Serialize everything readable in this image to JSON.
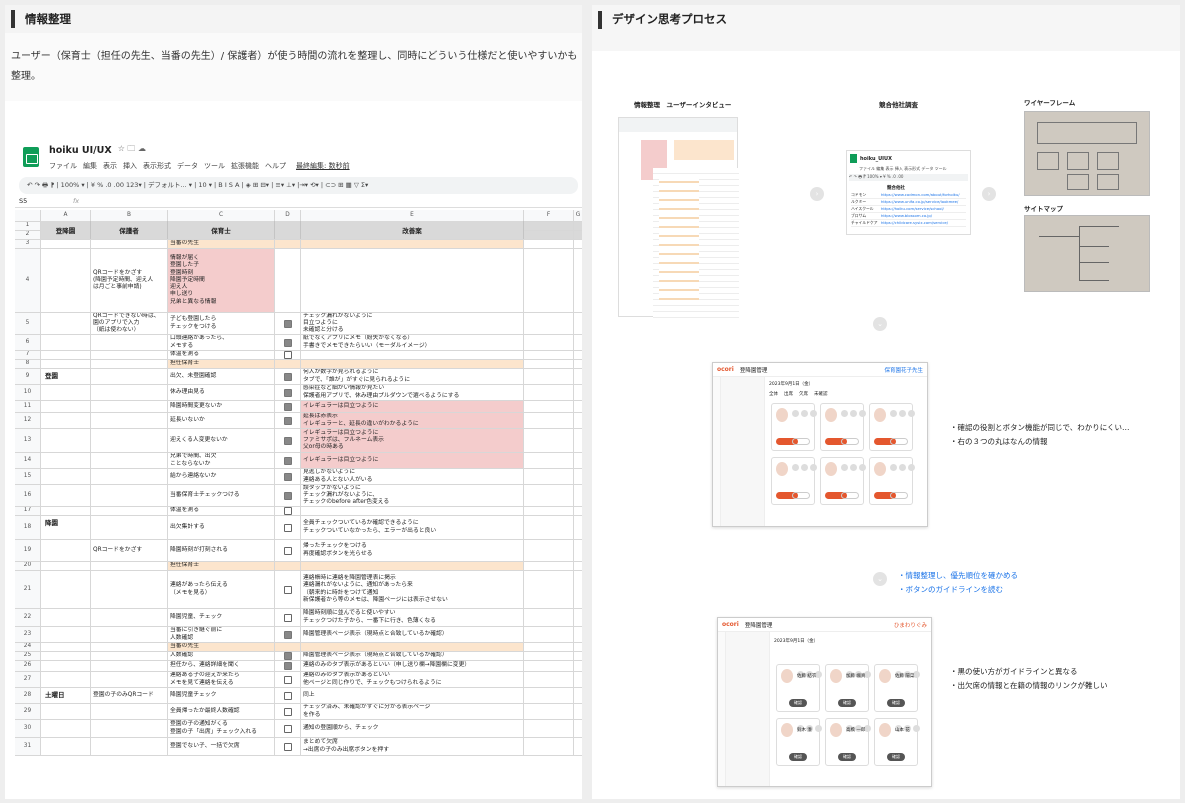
{
  "left": {
    "title": "情報整理",
    "description": "ユーザー（保育士（担任の先生、当番の先生）/ 保護者）が使う時間の流れを整理し、同時にどういう仕様だと使いやすいかも整理。",
    "sheet": {
      "title": "hoiku UI/UX",
      "title_icons": "☆ 🗀 ☁",
      "menu": [
        "ファイル",
        "編集",
        "表示",
        "挿入",
        "表示形式",
        "データ",
        "ツール",
        "拡張機能",
        "ヘルプ"
      ],
      "last_edit": "最終編集: 数秒前",
      "toolbar": "↶ ↷ 🖶 ⁋  |  100% ▾  |  ¥  %  .0  .00  123▾  |  デフォルト... ▾  |  10  ▾  |  B  I  S  A  |  ◈  ⊞  ⊟▾  |  ≡▾  ⊥▾  |⇥▾  ⟲▾  |  ⊂⊃  ⊞  ▦  ▽  Σ▾",
      "cell_ref": "S5",
      "fx": "fx",
      "columns": [
        "",
        "A",
        "B",
        "C",
        "D",
        "E",
        "F",
        "G"
      ],
      "headers": {
        "a": "登降園",
        "b": "保護者",
        "c": "保育士",
        "e": "改善案"
      },
      "merged": {
        "a_toko": "登園",
        "a_koen": "降園",
        "a_sat": "土曜日"
      },
      "rows": [
        {
          "n": "1",
          "b": "",
          "c": "",
          "e": "",
          "chk": "none",
          "style": "hdr"
        },
        {
          "n": "2",
          "b": "",
          "c": "",
          "e": "",
          "chk": "none",
          "style": "hdr"
        },
        {
          "n": "3",
          "b": "",
          "c": "当番の先生",
          "e": "",
          "chk": "none",
          "style": "orange"
        },
        {
          "n": "4",
          "b": "QRコードをかざす\n(降園予定時間、迎え人\nは月ごと事前申請)",
          "c": "情報が届く\n登園した子\n登園時刻\n降園予定時間\n迎え人\n申し送り\n兄弟と異なる情報",
          "e": "",
          "chk": "none",
          "style": "pink"
        },
        {
          "n": "5",
          "b": "QRコードできない時は、\n園のアプリで入力\n（紙は使わない）",
          "c": "子ども登園したら\nチェックをつける",
          "e": "チェック漏れがないように\n目立つように\n未確認と分ける",
          "chk": "on"
        },
        {
          "n": "6",
          "b": "",
          "c": "口頭連絡があったら、\nメモする",
          "e": "紙でなくアプリにメモ（紛失がなくなる）\n手書きでメモできたらいい（モーダルイメージ）",
          "chk": "on"
        },
        {
          "n": "7",
          "b": "",
          "c": "体温を測る",
          "e": "",
          "chk": "off"
        },
        {
          "n": "8",
          "b": "",
          "c": "担任保育士",
          "e": "",
          "chk": "none",
          "style": "orange"
        },
        {
          "n": "9",
          "b": "",
          "c": "出欠、未登園確認",
          "e": "何人か数字が見られるように\nタブで、「誰が」がすぐに見られるように",
          "chk": "on"
        },
        {
          "n": "10",
          "b": "",
          "c": "休み理由見る",
          "e": "感染症など細かい情報が見たい\n保護者用アプリで、休み理由プルダウンで選べるようにする",
          "chk": "on"
        },
        {
          "n": "11",
          "b": "",
          "c": "降園時間変更ないか",
          "e": "イレギュラーは目立つように",
          "chk": "on",
          "style": "pinkE"
        },
        {
          "n": "12",
          "b": "",
          "c": "延長いないか",
          "e": "延長は赤表示\nイレギュラーと、延長の違いがわかるように",
          "chk": "on",
          "style": "pinkE"
        },
        {
          "n": "13",
          "b": "",
          "c": "迎えくる人変更ないか",
          "e": "イレギュラーは目立つように\nファミサポは、フルネーム表示\n父or母の時ある",
          "chk": "on",
          "style": "pinkE"
        },
        {
          "n": "14",
          "b": "",
          "c": "兄弟で時間、出欠\nことならないか",
          "e": "イレギュラーは目立つように",
          "chk": "on",
          "style": "pinkE"
        },
        {
          "n": "15",
          "b": "",
          "c": "給から連絡ないか",
          "e": "見逃しがないように\n連絡ある人とない人がいる",
          "chk": "on"
        },
        {
          "n": "16",
          "b": "",
          "c": "当番保育士チェックつける",
          "e": "誤タップがないように\nチェック漏れがないように、\nチェックのbefore after色変える",
          "chk": "on"
        },
        {
          "n": "17",
          "b": "",
          "c": "体温を測る",
          "e": "",
          "chk": "off"
        },
        {
          "n": "18",
          "b": "",
          "c": "出欠集計する",
          "e": "全員チェックついているか確認できるように\nチェックついていなかったら、エラーが出ると良い",
          "chk": "off"
        },
        {
          "n": "19",
          "b": "QRコードをかざす",
          "c": "降園時刻が打刻される",
          "e": "帰ったチェックをつける\n再度確認ボタンを光らせる",
          "chk": "off"
        },
        {
          "n": "20",
          "b": "",
          "c": "担任保育士",
          "e": "",
          "chk": "none",
          "style": "orange"
        },
        {
          "n": "21",
          "b": "",
          "c": "連絡があったら伝える\n（メモを見る）",
          "e": "連絡帳時に連絡を降園管理表に掲示\n連絡漏れがないように、通知があったら来\n（朝来的に時計をつけて通知\n新保護者から等のメモは、降園ページには表示させない",
          "chk": "off"
        },
        {
          "n": "22",
          "b": "",
          "c": "降園児童、チェック",
          "e": "降園時刻順に並んでると使いやすい\nチェックつけた子から、一番下に行き、色薄くなる",
          "chk": "off"
        },
        {
          "n": "23",
          "b": "",
          "c": "当番に引き継ぐ前に\n人数確認",
          "e": "降園管理表ページ表示（現時点と合致しているか確認）",
          "chk": "on"
        },
        {
          "n": "24",
          "b": "",
          "c": "当番の先生",
          "e": "",
          "chk": "none",
          "style": "orange"
        },
        {
          "n": "25",
          "b": "",
          "c": "人数確認",
          "e": "降園管理表ページ表示（現時点と合致しているか確認）",
          "chk": "on"
        },
        {
          "n": "26",
          "b": "",
          "c": "担任から、連絡詳細を聞く",
          "e": "連絡のみのタブ表示があるといい（申し送り欄→降園欄に変更）",
          "chk": "on"
        },
        {
          "n": "27",
          "b": "",
          "c": "連絡ある子の迎えが来たら\nメモを見て連絡を伝える",
          "e": "連絡のみのタブ表示があるといい\n他ページと同じ作りで、チェックもつけられるように",
          "chk": "off"
        },
        {
          "n": "28",
          "b": "登園の子のみQRコード",
          "c": "降園児童チェック",
          "e": "同上",
          "chk": "off"
        },
        {
          "n": "29",
          "b": "",
          "c": "全員帰ったか最終人数確認",
          "e": "チェック済み、未確認がすぐに分かる表示ページ\nを作る",
          "chk": "off"
        },
        {
          "n": "30",
          "b": "",
          "c": "登園の子の通知がくる\n登園の子「出席」チェック入れる",
          "e": "通知の登園順から、チェック",
          "chk": "off"
        },
        {
          "n": "31",
          "b": "",
          "c": "登園でない子、一括で欠席",
          "e": "まとめて欠席\n→出席の子のみ出席ボタンを押す",
          "chk": "off"
        }
      ]
    }
  },
  "right": {
    "title": "デザイン思考プロセス",
    "labels": {
      "research": "情報整理　ユーザーインタビュー",
      "competitor": "競合他社調査",
      "wireframe": "ワイヤーフレーム",
      "sitemap": "サイトマップ"
    },
    "competitor_sheet": {
      "title": "hoiku_UIUX",
      "menu": "ファイル 編集 表示 挿入 表示形式 データ ツール",
      "toolbar": "↶ ↷ 🖶 ⁋ 100% ▾ ¥ % .0 .00",
      "column_header": "競合他社",
      "names": [
        "コドモン",
        "ルクミー",
        "ハイスクール",
        "ブロサム",
        "チャイルドケア"
      ],
      "urls": [
        "https://www.codmon.com/about/forhoiku/",
        "https://www.unifa.co.jp/service/lookmee/",
        "https://hoiku.com/service/school/",
        "https://www.blossom.co.jp/",
        "https://childcare.sysix.com/service/"
      ]
    },
    "app1": {
      "brand": "ocori",
      "page": "登降園管理",
      "user": "保育園花子先生",
      "date": "2023年9月1日（金）",
      "tabs": [
        "全体",
        "出席",
        "欠席",
        "未確認"
      ],
      "note_lines": [
        "・確認の役割とボタン機能が同じで、わかりにくい…",
        "・右の３つの丸はなんの情報"
      ]
    },
    "mid_notes": [
      "・情報整理し、優先順位を確かめる",
      "・ボタンのガイドラインを読む"
    ],
    "app2": {
      "brand": "ocori",
      "page": "登降園管理",
      "user": "ひまわりぐみ",
      "date": "2023年9月1日（金）",
      "names": [
        "佐藤 結衣",
        "加藤 颯真",
        "佐藤 陽菜",
        "鈴木 湊",
        "高橋 一郎",
        "山本 花"
      ],
      "btn": "確認",
      "note_lines": [
        "・黒の使い方がガイドラインと異なる",
        "・出欠席の情報と在籍の情報のリンクが難しい"
      ]
    },
    "colors": {
      "accent": "#e4572e",
      "pink": "#f4cccc",
      "orange": "#fce5cd",
      "blue": "#1a73e8",
      "green": "#0f9d58"
    }
  }
}
